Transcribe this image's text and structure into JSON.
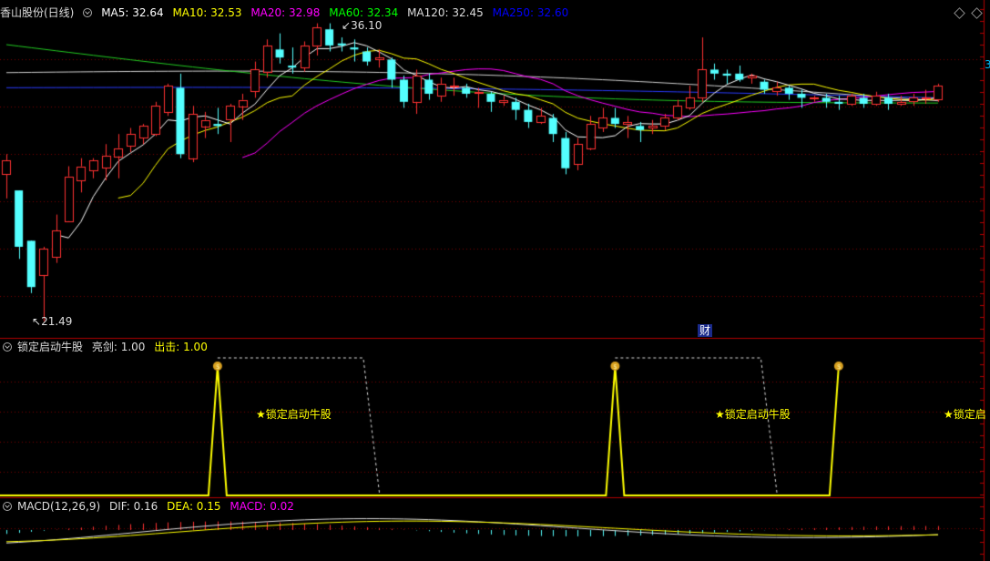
{
  "main": {
    "stock_name": "香山股份(日线)",
    "ma": [
      {
        "label": "MA5: 32.64",
        "color": "#ffffff"
      },
      {
        "label": "MA10: 32.53",
        "color": "#ffff00"
      },
      {
        "label": "MA20: 32.98",
        "color": "#ff00ff"
      },
      {
        "label": "MA60: 32.34",
        "color": "#00ff00"
      },
      {
        "label": "MA120: 32.45",
        "color": "#dddddd"
      },
      {
        "label": "MA250: 32.60",
        "color": "#0000ff"
      }
    ],
    "high_label": "36.10",
    "low_label": "21.49",
    "event_badge": "财",
    "right_price_label": "3"
  },
  "indicator": {
    "title": "锁定启动牛股",
    "items": [
      {
        "label": "亮剑: 1.00",
        "color": "#dddddd"
      },
      {
        "label": "出击: 1.00",
        "color": "#ffff00"
      }
    ],
    "signal_labels": [
      "★锁定启动牛股",
      "★锁定启动牛股",
      "★锁定启"
    ]
  },
  "macd": {
    "title": "MACD(12,26,9)",
    "items": [
      {
        "label": "DIF: 0.16",
        "color": "#dddddd"
      },
      {
        "label": "DEA: 0.15",
        "color": "#ffff00"
      },
      {
        "label": "MACD: 0.02",
        "color": "#ff00ff"
      }
    ]
  },
  "colors": {
    "up": "#ff3232",
    "down": "#54ffff",
    "grid": "#7a0000",
    "border": "#b00000",
    "signal": "#ffff00"
  },
  "chart_data": {
    "type": "candlestick",
    "price_range": [
      21.49,
      36.1
    ],
    "candles": [
      [
        28.8,
        29.5,
        27.6,
        29.8
      ],
      [
        28.0,
        25.2,
        24.6,
        28.0
      ],
      [
        25.5,
        23.2,
        22.9,
        25.5
      ],
      [
        23.8,
        25.1,
        21.5,
        25.2
      ],
      [
        24.7,
        26.0,
        24.4,
        26.8
      ],
      [
        26.5,
        28.7,
        26.5,
        29.2
      ],
      [
        28.5,
        29.2,
        27.9,
        29.6
      ],
      [
        29.0,
        29.5,
        28.6,
        29.6
      ],
      [
        29.1,
        29.7,
        28.5,
        30.3
      ],
      [
        29.7,
        30.1,
        28.6,
        30.8
      ],
      [
        30.2,
        30.8,
        29.9,
        31.1
      ],
      [
        30.6,
        31.2,
        30.3,
        31.3
      ],
      [
        30.8,
        32.2,
        30.7,
        32.4
      ],
      [
        31.9,
        33.2,
        31.7,
        33.3
      ],
      [
        33.1,
        29.8,
        29.6,
        33.8
      ],
      [
        29.6,
        31.8,
        29.4,
        32.2
      ],
      [
        31.2,
        31.5,
        30.6,
        31.9
      ],
      [
        31.3,
        31.2,
        30.8,
        32.1
      ],
      [
        31.5,
        32.2,
        30.4,
        32.3
      ],
      [
        32.2,
        32.5,
        31.5,
        32.8
      ],
      [
        32.9,
        34.0,
        32.6,
        34.4
      ],
      [
        33.9,
        35.2,
        33.6,
        35.5
      ],
      [
        35.0,
        34.6,
        34.3,
        35.8
      ],
      [
        34.2,
        34.1,
        33.8,
        35.1
      ],
      [
        34.1,
        35.2,
        33.9,
        35.4
      ],
      [
        35.2,
        36.1,
        34.7,
        36.3
      ],
      [
        36.0,
        35.2,
        34.9,
        36.3
      ],
      [
        35.3,
        35.2,
        34.9,
        35.6
      ],
      [
        35.1,
        35.0,
        34.4,
        35.5
      ],
      [
        34.9,
        34.4,
        34.2,
        35.1
      ],
      [
        34.5,
        34.6,
        34.1,
        35.0
      ],
      [
        34.5,
        33.5,
        33.1,
        34.6
      ],
      [
        33.5,
        32.4,
        32.1,
        33.7
      ],
      [
        32.4,
        33.7,
        31.8,
        34.0
      ],
      [
        33.5,
        32.8,
        32.5,
        33.8
      ],
      [
        32.7,
        33.3,
        32.4,
        33.6
      ],
      [
        33.2,
        33.2,
        32.7,
        33.6
      ],
      [
        33.1,
        32.8,
        32.6,
        33.3
      ],
      [
        32.9,
        32.9,
        32.1,
        33.1
      ],
      [
        32.8,
        32.4,
        31.9,
        32.9
      ],
      [
        32.4,
        32.5,
        32.2,
        32.7
      ],
      [
        32.4,
        32.0,
        31.5,
        32.6
      ],
      [
        32.0,
        31.4,
        31.1,
        32.3
      ],
      [
        31.4,
        31.7,
        31.3,
        32.1
      ],
      [
        31.6,
        30.8,
        30.4,
        31.8
      ],
      [
        30.6,
        29.1,
        28.8,
        30.9
      ],
      [
        29.3,
        30.3,
        29.0,
        30.6
      ],
      [
        30.1,
        31.3,
        30.0,
        31.7
      ],
      [
        31.1,
        31.6,
        30.9,
        32.1
      ],
      [
        31.6,
        31.3,
        31.1,
        32.1
      ],
      [
        31.3,
        31.4,
        30.6,
        31.7
      ],
      [
        31.2,
        31.0,
        30.4,
        31.4
      ],
      [
        31.1,
        31.2,
        30.8,
        31.5
      ],
      [
        31.2,
        31.6,
        31.0,
        31.8
      ],
      [
        31.6,
        32.2,
        31.5,
        32.5
      ],
      [
        32.1,
        32.6,
        32.0,
        33.2
      ],
      [
        32.6,
        34.0,
        32.4,
        35.6
      ],
      [
        34.0,
        33.8,
        33.5,
        34.3
      ],
      [
        33.8,
        33.7,
        33.3,
        34.0
      ],
      [
        33.8,
        33.5,
        33.4,
        34.2
      ],
      [
        33.6,
        33.7,
        33.3,
        33.8
      ],
      [
        33.4,
        33.0,
        32.8,
        33.5
      ],
      [
        32.9,
        33.1,
        32.7,
        33.4
      ],
      [
        33.1,
        32.8,
        32.5,
        33.2
      ],
      [
        32.8,
        32.6,
        32.1,
        33.0
      ],
      [
        32.6,
        32.6,
        32.4,
        32.7
      ],
      [
        32.6,
        32.4,
        32.1,
        32.8
      ],
      [
        32.4,
        32.3,
        32.0,
        32.7
      ],
      [
        32.3,
        32.7,
        32.2,
        32.8
      ],
      [
        32.6,
        32.3,
        32.1,
        32.8
      ],
      [
        32.3,
        32.7,
        32.2,
        32.9
      ],
      [
        32.6,
        32.3,
        32.0,
        32.8
      ],
      [
        32.3,
        32.4,
        32.2,
        32.7
      ],
      [
        32.4,
        32.6,
        32.2,
        32.8
      ],
      [
        32.6,
        32.6,
        32.3,
        33.0
      ],
      [
        32.5,
        33.2,
        32.4,
        33.3
      ]
    ],
    "signal_events": [
      17,
      49,
      67
    ],
    "macd_recent": {
      "DIF": 0.16,
      "DEA": 0.15,
      "MACD": 0.02
    }
  }
}
